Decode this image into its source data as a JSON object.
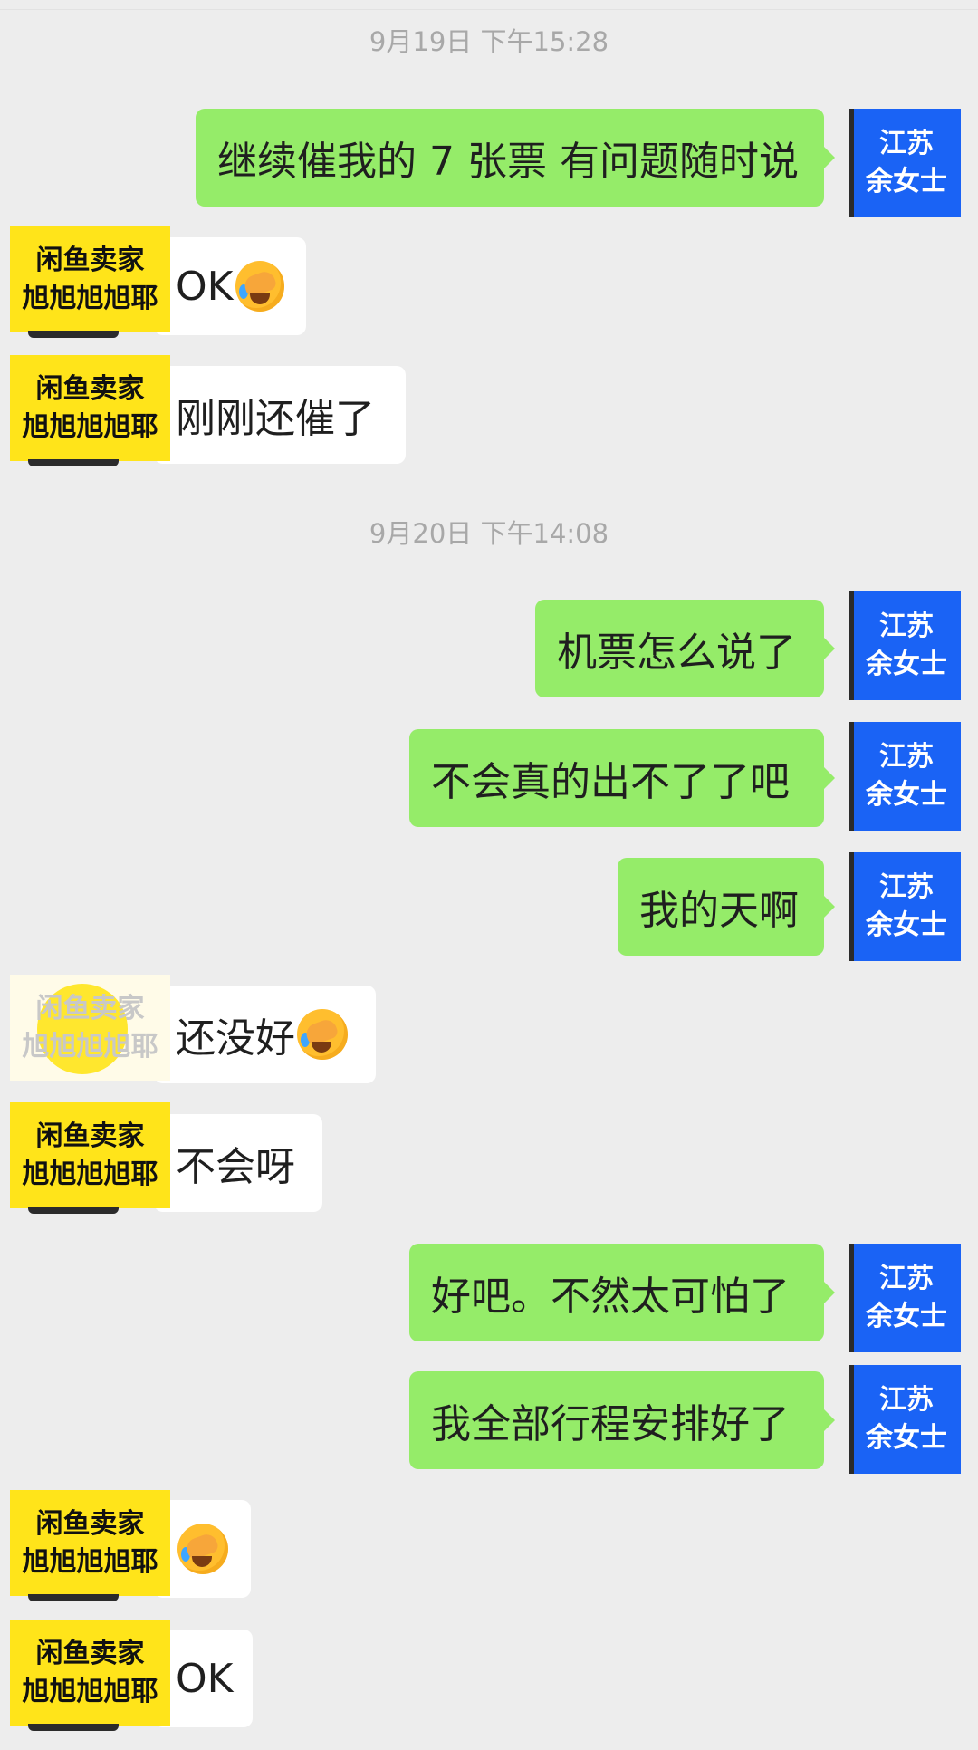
{
  "timestamps": [
    "9月19日 下午15:28",
    "9月20日 下午14:08"
  ],
  "avatars": {
    "outgoing": {
      "line1": "江苏",
      "line2": "余女士"
    },
    "incoming": {
      "line1": "闲鱼卖家",
      "line2": "旭旭旭旭耶"
    }
  },
  "messages": [
    {
      "dir": "out",
      "text": "继续催我的 7 张票 有问题随时说"
    },
    {
      "dir": "in",
      "text": "OK",
      "emoji": "facepalm-emoji"
    },
    {
      "dir": "in",
      "text": "刚刚还催了"
    },
    {
      "dir": "out",
      "text": "机票怎么说了"
    },
    {
      "dir": "out",
      "text": "不会真的出不了了吧"
    },
    {
      "dir": "out",
      "text": "我的天啊"
    },
    {
      "dir": "in",
      "text": "还没好",
      "emoji": "facepalm-emoji"
    },
    {
      "dir": "in",
      "text": "不会呀"
    },
    {
      "dir": "out",
      "text": "好吧。不然太可怕了"
    },
    {
      "dir": "out",
      "text": "我全部行程安排好了"
    },
    {
      "dir": "in",
      "text": "",
      "emoji": "facepalm-emoji"
    },
    {
      "dir": "in",
      "text": "OK"
    }
  ],
  "colors": {
    "background": "#ededed",
    "outgoing_bubble": "#95ec69",
    "incoming_bubble": "#ffffff",
    "outgoing_avatar": "#1a63f5",
    "incoming_avatar": "#ffe41a"
  }
}
